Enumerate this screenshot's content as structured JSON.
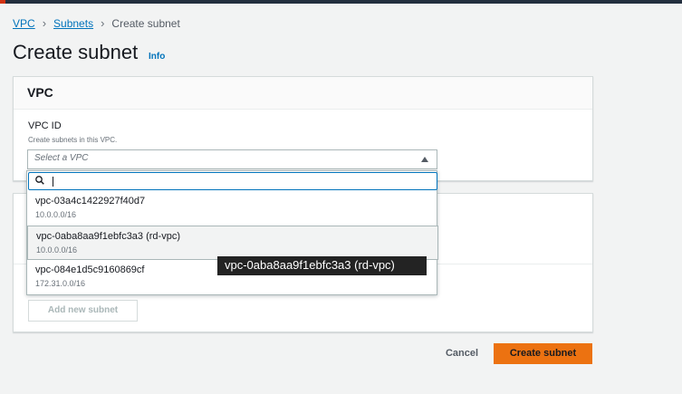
{
  "breadcrumb": {
    "items": [
      {
        "label": "VPC"
      },
      {
        "label": "Subnets"
      },
      {
        "label": "Create subnet"
      }
    ]
  },
  "page": {
    "title": "Create subnet",
    "info_link": "Info"
  },
  "vpc_panel": {
    "header": "VPC",
    "vpc_id_label": "VPC ID",
    "vpc_id_description": "Create subnets in this VPC.",
    "select_placeholder": "Select a VPC",
    "options": [
      {
        "title": "vpc-03a4c1422927f40d7",
        "cidr": "10.0.0.0/16"
      },
      {
        "title": "vpc-0aba8aa9f1ebfc3a3 (rd-vpc)",
        "cidr": "10.0.0.0/16"
      },
      {
        "title": "vpc-084e1d5c9160869cf",
        "cidr": "172.31.0.0/16"
      }
    ],
    "hover_tooltip": "vpc-0aba8aa9f1ebfc3a3 (rd-vpc)"
  },
  "subnets_panel": {
    "add_button": "Add new subnet"
  },
  "footer": {
    "cancel_label": "Cancel",
    "create_label": "Create subnet"
  },
  "colors": {
    "link": "#0073bb",
    "primary_button": "#ec7211",
    "top_nav": "#232f3e"
  }
}
